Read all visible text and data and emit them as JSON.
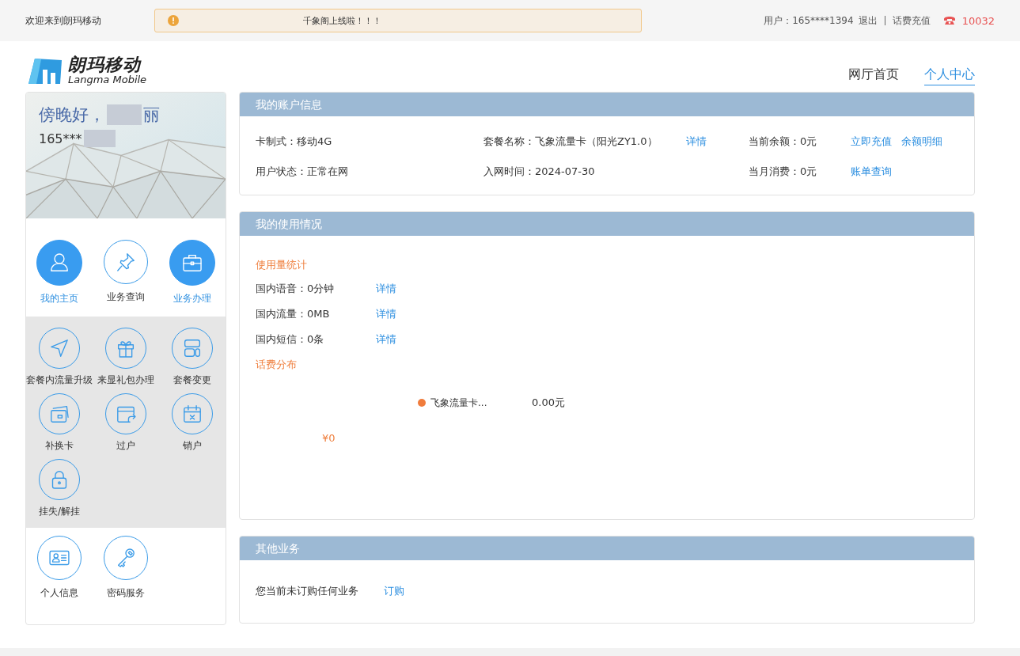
{
  "top_bar": {
    "welcome": "欢迎来到朗玛移动",
    "notice": "千象阁上线啦！！！",
    "user_label": "用户：165****1394",
    "links": [
      "退出",
      "话费充值"
    ],
    "hotline": "10032"
  },
  "header": {
    "logo_title": "朗玛移动",
    "logo_subtitle": "Langma Mobile",
    "nav": [
      {
        "label": "网厅首页",
        "selected": false
      },
      {
        "label": "个人中心",
        "selected": true
      }
    ]
  },
  "profile": {
    "greeting": "傍晚好，",
    "name_end": "丽",
    "phone": "165***"
  },
  "main_nav": [
    {
      "label": "我的主页",
      "kind": "person",
      "active": true
    },
    {
      "label": "业务查询",
      "kind": "pin",
      "active": false
    },
    {
      "label": "业务办理",
      "kind": "briefcase",
      "active": true
    }
  ],
  "service_items": [
    {
      "label": "套餐内流量升级",
      "kind": "send"
    },
    {
      "label": "来显礼包办理",
      "kind": "gift"
    },
    {
      "label": "套餐变更",
      "kind": "layout"
    },
    {
      "label": "补换卡",
      "kind": "cards"
    },
    {
      "label": "过户",
      "kind": "transfer"
    },
    {
      "label": "销户",
      "kind": "calendar"
    },
    {
      "label": "挂失/解挂",
      "kind": "lock"
    }
  ],
  "bottom_nav": [
    {
      "label": "个人信息",
      "kind": "idcard"
    },
    {
      "label": "密码服务",
      "kind": "key"
    }
  ],
  "account": {
    "title": "我的账户信息",
    "rows": [
      [
        {
          "label": "卡制式：",
          "value": "移动4G"
        },
        {
          "label": "套餐名称：",
          "value": "飞象流量卡（阳光ZY1.0）",
          "links": [
            "详情"
          ]
        },
        {
          "label": "当前余额：",
          "value": "0元",
          "links": [
            "立即充值",
            "余额明细"
          ]
        }
      ],
      [
        {
          "label": "用户状态：",
          "value": "正常在网"
        },
        {
          "label": "入网时间：",
          "value": "2024-07-30"
        },
        {
          "label": "当月消费：",
          "value": "0元",
          "links": [
            "账单查询"
          ]
        }
      ]
    ]
  },
  "usage": {
    "title": "我的使用情况",
    "stats_heading": "使用量统计",
    "stats": [
      {
        "text": "国内语音：0分钟",
        "link": "详情"
      },
      {
        "text": "国内流量：0MB",
        "link": "详情"
      },
      {
        "text": "国内短信：0条",
        "link": "详情"
      }
    ],
    "fee_heading": "话费分布",
    "fee_total": "¥0",
    "legend": [
      {
        "name": "飞象流量卡...",
        "amount": "0.00元",
        "color": "#f07c3c"
      }
    ]
  },
  "other": {
    "title": "其他业务",
    "text": "您当前未订购任何业务",
    "link": "订购"
  }
}
